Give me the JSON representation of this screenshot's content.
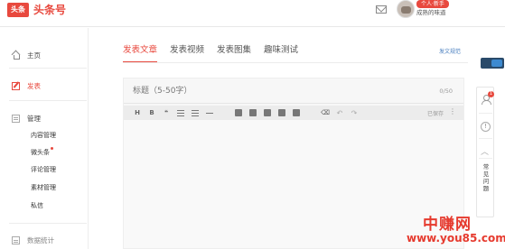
{
  "header": {
    "logo_icon_text": "头条",
    "logo_text": "头条号",
    "user_badge": "个人·新手",
    "username": "成熟的味道"
  },
  "sidebar": {
    "items": [
      {
        "label": "主页",
        "icon": "home-icon",
        "active": false
      },
      {
        "label": "发表",
        "icon": "edit-icon",
        "active": true
      },
      {
        "label": "管理",
        "icon": "manage-icon",
        "active": false
      }
    ],
    "sub_items": [
      {
        "label": "内容管理"
      },
      {
        "label": "微头条",
        "has_dot": true
      },
      {
        "label": "评论管理"
      },
      {
        "label": "素材管理"
      },
      {
        "label": "私信"
      }
    ],
    "bottom_item": {
      "label": "数据统计",
      "icon": "stats-icon"
    }
  },
  "tabs": [
    {
      "label": "发表文章",
      "active": true
    },
    {
      "label": "发表视频",
      "active": false
    },
    {
      "label": "发表图集",
      "active": false
    },
    {
      "label": "趣味测试",
      "active": false
    }
  ],
  "publish_spec_link": "发文规范",
  "editor": {
    "title_placeholder": "标题（5-50字）",
    "char_count": "0/50",
    "toolbar": [
      "H",
      "B",
      "bb",
      "list-ul",
      "list-ol",
      "hr",
      "image",
      "video",
      "audio",
      "vote",
      "product",
      "format-clear",
      "undo",
      "redo"
    ],
    "saved_status": "已保存"
  },
  "right_bar": {
    "notification_count": "1",
    "help_label": "常见问题"
  },
  "watermark": {
    "cn": "中赚网",
    "url": "www.you85.com"
  },
  "colors": {
    "accent": "#e8493e",
    "link": "#4a7fbf"
  }
}
